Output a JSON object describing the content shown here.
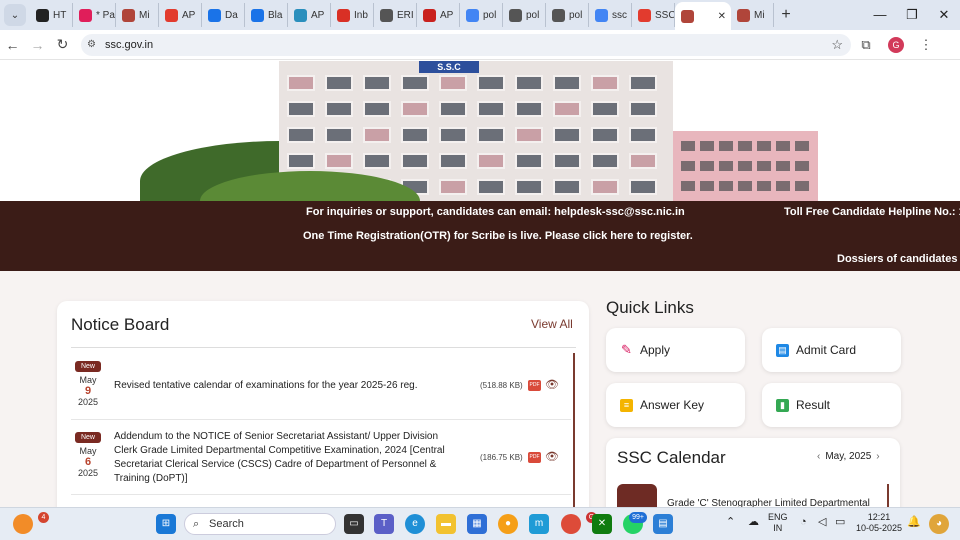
{
  "browser": {
    "tabs": [
      {
        "title": "HT",
        "icon": "d-icon",
        "color": "#222222"
      },
      {
        "title": "* Pa",
        "icon": "slack-icon",
        "color": "#e01e5a"
      },
      {
        "title": "Mi",
        "icon": "emblem-icon",
        "color": "#b0453a"
      },
      {
        "title": "AP",
        "icon": "red-circle-icon",
        "color": "#e23b2e"
      },
      {
        "title": "Da",
        "icon": "docs-icon",
        "color": "#1a73e8"
      },
      {
        "title": "Bla",
        "icon": "docs-icon",
        "color": "#1a73e8"
      },
      {
        "title": "AP",
        "icon": "ht-icon",
        "color": "#2a8fbd"
      },
      {
        "title": "Inb",
        "icon": "gmail-icon",
        "color": "#d93025"
      },
      {
        "title": "ERI",
        "icon": "globe-icon",
        "color": "#555555"
      },
      {
        "title": "AP",
        "icon": "toi-icon",
        "color": "#c9211e"
      },
      {
        "title": "pol",
        "icon": "google-icon",
        "color": "#4285f4"
      },
      {
        "title": "pol",
        "icon": "globe-icon",
        "color": "#555555"
      },
      {
        "title": "pol",
        "icon": "globe-icon",
        "color": "#555555"
      },
      {
        "title": "ssc",
        "icon": "google-icon",
        "color": "#4285f4"
      },
      {
        "title": "SSC",
        "icon": "red-circle-icon",
        "color": "#e23b2e"
      }
    ],
    "active_tab": {
      "icon": "emblem-icon",
      "color": "#b0453a"
    },
    "last_tab": {
      "title": "Mi",
      "icon": "emblem-icon",
      "color": "#b0453a"
    },
    "url": "ssc.gov.in",
    "profile_initial": "G"
  },
  "hero": {
    "sign": "S.S.C"
  },
  "banner": {
    "line1": "For inquiries or support, candidates can email: helpdesk-ssc@ssc.nic.in",
    "line1b": "Toll Free Candidate Helpline No.: 1",
    "line2": "One Time Registration(OTR) for Scribe is live. Please click here to register.",
    "line3": "Dossiers of candidates"
  },
  "notice_board": {
    "title": "Notice Board",
    "view_all": "View All",
    "items": [
      {
        "badge": "New",
        "month": "May",
        "day": "9",
        "year": "2025",
        "text": "Revised tentative calendar of examinations for the year 2025-26 reg.",
        "size": "(518.88 KB)",
        "pdf": "PDF"
      },
      {
        "badge": "New",
        "month": "May",
        "day": "6",
        "year": "2025",
        "text": "Addendum to the NOTICE of Senior Secretariat Assistant/ Upper Division Clerk Grade Limited Departmental Competitive Examination, 2024 [Central Secretariat Clerical Service (CSCS) Cadre of Department of Personnel & Training (DoPT)]",
        "size": "(186.75 KB)",
        "pdf": "PDF"
      }
    ]
  },
  "quick_links": {
    "title": "Quick Links",
    "items": [
      {
        "label": "Apply",
        "icon": "pencil-icon",
        "color": "#d81b60"
      },
      {
        "label": "Admit Card",
        "icon": "id-card-icon",
        "color": "#1e88e5"
      },
      {
        "label": "Answer Key",
        "icon": "list-icon",
        "color": "#f4b400"
      },
      {
        "label": "Result",
        "icon": "bar-chart-icon",
        "color": "#34a853"
      }
    ]
  },
  "calendar": {
    "title": "SSC Calendar",
    "month": "May, 2025",
    "event": "Grade 'C' Stenographer Limited Departmental"
  },
  "taskbar": {
    "weather_badge": "4",
    "search_placeholder": "Search",
    "whatsapp_badge": "99+",
    "chrome_badge": "G",
    "lang": "ENG",
    "region": "IN",
    "time": "12:21",
    "date": "10-05-2025"
  }
}
